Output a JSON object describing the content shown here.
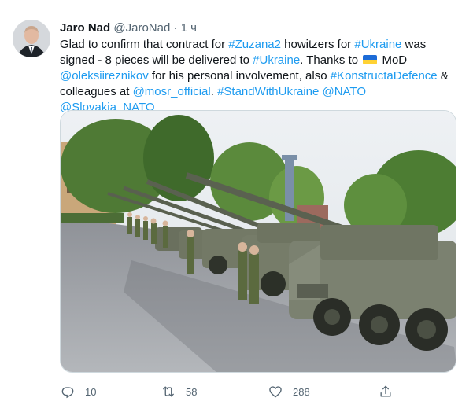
{
  "tweet": {
    "author_name": "Jaro Nad",
    "author_handle": "@JaroNad",
    "separator": "·",
    "time": "1 ч",
    "text_segments": [
      {
        "t": "Glad to confirm that contract for ",
        "link": false
      },
      {
        "t": "#Zuzana2",
        "link": true
      },
      {
        "t": " howitzers for ",
        "link": false
      },
      {
        "t": "#Ukraine",
        "link": true
      },
      {
        "t": " was signed - 8 pieces will be delivered to ",
        "link": false
      },
      {
        "t": "#Ukraine",
        "link": true
      },
      {
        "t": ". Thanks to ",
        "link": false
      },
      {
        "t": "__FLAG__",
        "link": false
      },
      {
        "t": " MoD ",
        "link": false
      },
      {
        "t": "@oleksiireznikov",
        "link": true
      },
      {
        "t": " for his personal involvement, also ",
        "link": false
      },
      {
        "t": "#KonstructaDefence",
        "link": true
      },
      {
        "t": " & colleagues at ",
        "link": false
      },
      {
        "t": "@mosr_official",
        "link": true
      },
      {
        "t": ". ",
        "link": false
      },
      {
        "t": "#StandWithUkraine",
        "link": true
      },
      {
        "t": " ",
        "link": false
      },
      {
        "t": "@NATO",
        "link": true
      },
      {
        "t": " ",
        "link": false
      },
      {
        "t": "@Slovakia_NATO",
        "link": true
      }
    ],
    "media_icon": "photo-self-propelled-howitzers-lineup",
    "actions": {
      "reply_count": "10",
      "retweet_count": "58",
      "like_count": "288"
    }
  },
  "colors": {
    "link": "#1d9bf0",
    "secondary_text": "#536471",
    "flag_blue": "#1c6bd7",
    "flag_yellow": "#ffd234"
  }
}
